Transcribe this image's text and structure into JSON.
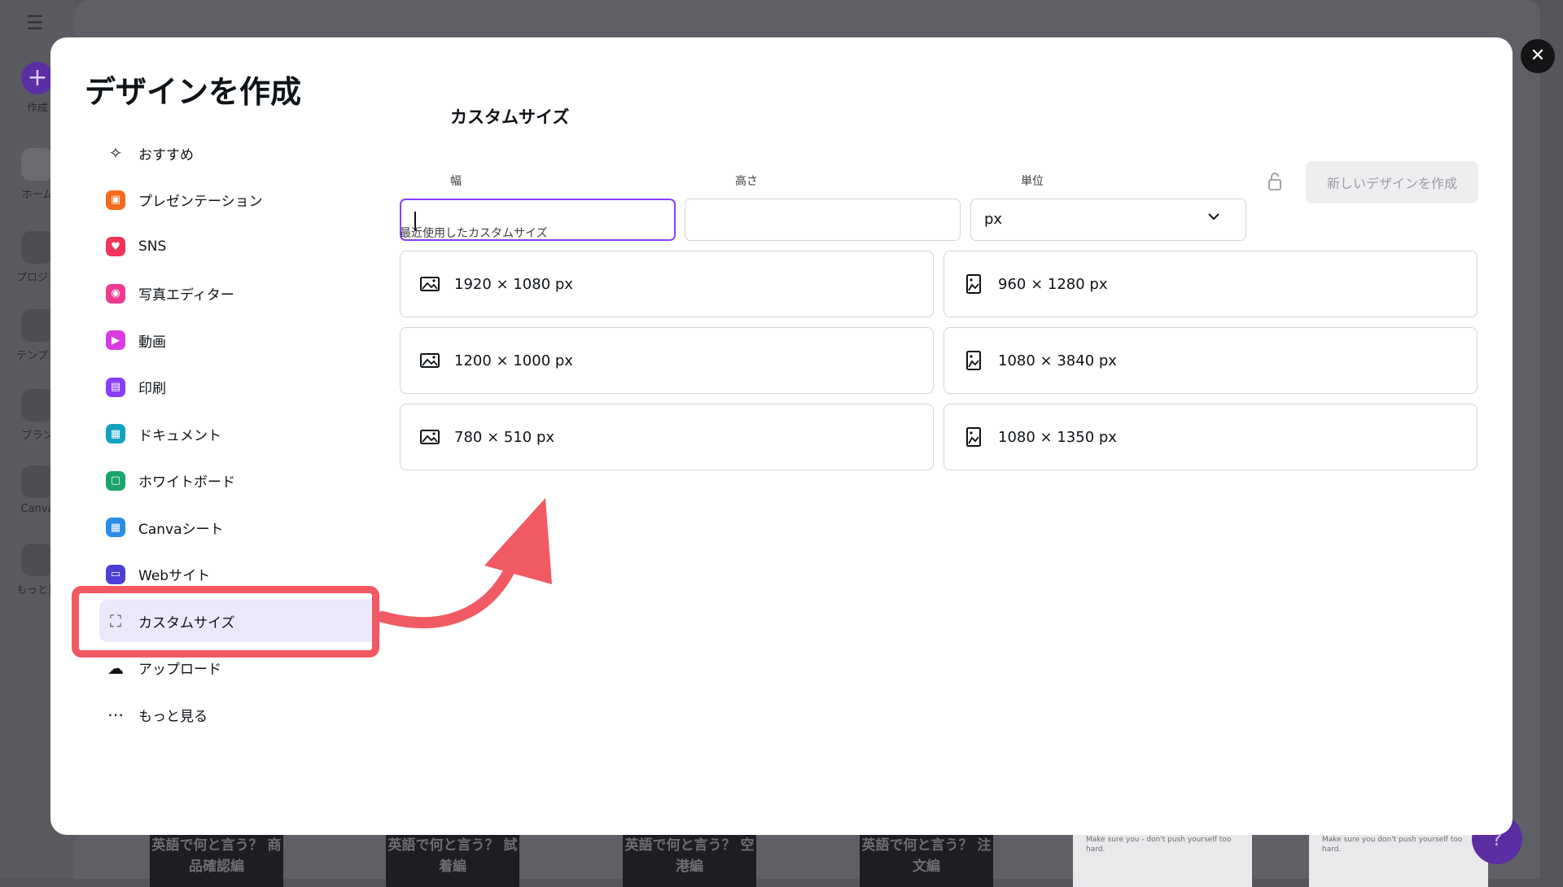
{
  "modal": {
    "title": "デザインを作成",
    "close_icon": "close-icon",
    "nav": [
      {
        "label": "おすすめ",
        "icon": "sparkle-icon",
        "color": "#0e1318"
      },
      {
        "label": "プレゼンテーション",
        "icon": "presentation-icon",
        "color": "#f36a1e"
      },
      {
        "label": "SNS",
        "icon": "heart-icon",
        "color": "#f0345a"
      },
      {
        "label": "写真エディター",
        "icon": "camera-icon",
        "color": "#f03a92"
      },
      {
        "label": "動画",
        "icon": "video-icon",
        "color": "#d93be0"
      },
      {
        "label": "印刷",
        "icon": "printer-icon",
        "color": "#8b3dff"
      },
      {
        "label": "ドキュメント",
        "icon": "document-icon",
        "color": "#13a3c1"
      },
      {
        "label": "ホワイトボード",
        "icon": "whiteboard-icon",
        "color": "#1ba56a"
      },
      {
        "label": "Canvaシート",
        "icon": "sheet-icon",
        "color": "#2a8ce8"
      },
      {
        "label": "Webサイト",
        "icon": "website-icon",
        "color": "#4b3fd6"
      },
      {
        "label": "カスタムサイズ",
        "icon": "custom-size-icon",
        "color": "#4a4a52",
        "active": true
      },
      {
        "label": "アップロード",
        "icon": "upload-cloud-icon",
        "color": "#0e1318"
      },
      {
        "label": "もっと見る",
        "icon": "more-dots-icon",
        "color": "#0e1318"
      }
    ],
    "custom": {
      "title": "カスタムサイズ",
      "width_label": "幅",
      "height_label": "高さ",
      "unit_label": "単位",
      "width_value": "",
      "height_value": "",
      "unit_value": "px",
      "create_button": "新しいデザインを作成",
      "recent_label": "最近使用したカスタムサイズ",
      "recent": [
        {
          "label": "1920 × 1080 px",
          "orientation": "landscape"
        },
        {
          "label": "960 × 1280 px",
          "orientation": "portrait"
        },
        {
          "label": "1200 × 1000 px",
          "orientation": "landscape"
        },
        {
          "label": "1080 × 3840 px",
          "orientation": "portrait"
        },
        {
          "label": "780 × 510 px",
          "orientation": "landscape"
        },
        {
          "label": "1080 × 1350 px",
          "orientation": "portrait"
        }
      ]
    }
  },
  "background": {
    "sidebar": [
      {
        "label": "作成"
      },
      {
        "label": "ホーム"
      },
      {
        "label": "プロジェ"
      },
      {
        "label": "テンプレ"
      },
      {
        "label": "ブラン"
      },
      {
        "label": "Canva"
      },
      {
        "label": "もっと見"
      }
    ],
    "thumbs": [
      {
        "text": "英語で何と言う？ 商品確認編"
      },
      {
        "text": "英語で何と言う？ 試着編"
      },
      {
        "text": "英語で何と言う？ 空港編"
      },
      {
        "text": "英語で何と言う？ 注文編"
      },
      {
        "text": "Make sure you - don't push yourself too hard."
      },
      {
        "text": "Make sure you don't push yourself too hard."
      }
    ]
  },
  "colors": {
    "accent": "#8b3dff",
    "highlight": "#f15a62"
  }
}
